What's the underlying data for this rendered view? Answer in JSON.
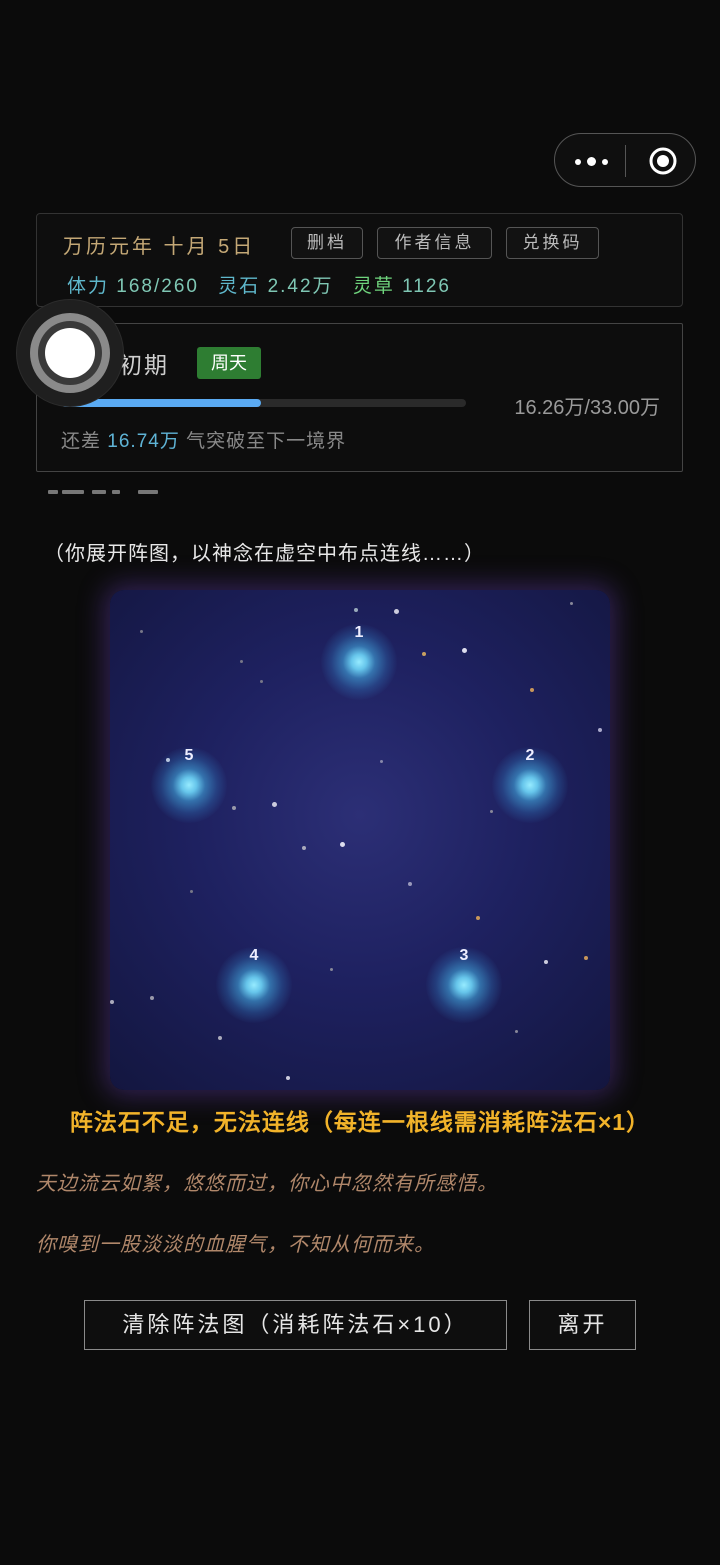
{
  "colors": {
    "background": "#0b0b0b",
    "accent_gold": "#c4a876",
    "warning": "#f2b32a",
    "progress": "#5aaaf2",
    "badge_green": "#2e7d32",
    "log_text": "#b0876a"
  },
  "capsule": {
    "more_icon": "more-dots-icon",
    "close_icon": "target-close-icon"
  },
  "status": {
    "date": "万历元年 十月 5日",
    "buttons": {
      "delete_save": "删档",
      "author_info": "作者信息",
      "redeem_code": "兑换码"
    },
    "stamina_label": "体力",
    "stamina_value": "168/260",
    "spirit_stone_label": "灵石",
    "spirit_stone_value": "2.42万",
    "herb_label": "灵草",
    "herb_value": "1126"
  },
  "realm": {
    "name": "初期",
    "badge": "周天",
    "progress_fraction": 0.4927,
    "exp_text": "16.26万/33.00万",
    "remaining_prefix": "还差",
    "remaining_value": "16.74万",
    "remaining_suffix": "气突破至下一境界"
  },
  "intro_text": "（你展开阵图，以神念在虚空中布点连线……）",
  "formation": {
    "nodes": [
      {
        "label": "1"
      },
      {
        "label": "2"
      },
      {
        "label": "3"
      },
      {
        "label": "4"
      },
      {
        "label": "5"
      }
    ]
  },
  "warning_text": "阵法石不足，无法连线（每连一根线需消耗阵法石×1）",
  "logs": [
    "天边流云如絮，悠悠而过，你心中忽然有所感悟。",
    "你嗅到一股淡淡的血腥气，不知从何而来。"
  ],
  "actions": {
    "clear_label": "清除阵法图（消耗阵法石×10）",
    "leave_label": "离开"
  }
}
